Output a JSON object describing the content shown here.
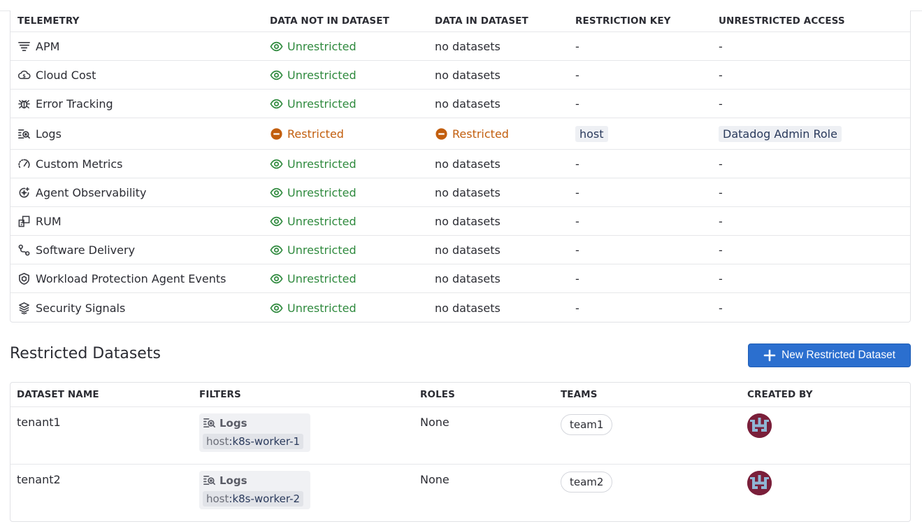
{
  "telemetry_table": {
    "headers": [
      "TELEMETRY",
      "DATA NOT IN DATASET",
      "DATA IN DATASET",
      "RESTRICTION KEY",
      "UNRESTRICTED ACCESS"
    ],
    "rows": [
      {
        "name": "APM",
        "icon": "apm-icon",
        "not_in_dataset": "Unrestricted",
        "not_in_status": "unrestricted",
        "in_dataset": "no datasets",
        "in_status": "text",
        "restriction_key": "-",
        "unrestricted_access": "-"
      },
      {
        "name": "Cloud Cost",
        "icon": "cloud-cost-icon",
        "not_in_dataset": "Unrestricted",
        "not_in_status": "unrestricted",
        "in_dataset": "no datasets",
        "in_status": "text",
        "restriction_key": "-",
        "unrestricted_access": "-"
      },
      {
        "name": "Error Tracking",
        "icon": "bug-icon",
        "not_in_dataset": "Unrestricted",
        "not_in_status": "unrestricted",
        "in_dataset": "no datasets",
        "in_status": "text",
        "restriction_key": "-",
        "unrestricted_access": "-"
      },
      {
        "name": "Logs",
        "icon": "logs-icon",
        "not_in_dataset": "Restricted",
        "not_in_status": "restricted",
        "in_dataset": "Restricted",
        "in_status": "restricted",
        "restriction_key": "host",
        "unrestricted_access": "Datadog Admin Role"
      },
      {
        "name": "Custom Metrics",
        "icon": "gauge-icon",
        "not_in_dataset": "Unrestricted",
        "not_in_status": "unrestricted",
        "in_dataset": "no datasets",
        "in_status": "text",
        "restriction_key": "-",
        "unrestricted_access": "-"
      },
      {
        "name": "Agent Observability",
        "icon": "agent-icon",
        "not_in_dataset": "Unrestricted",
        "not_in_status": "unrestricted",
        "in_dataset": "no datasets",
        "in_status": "text",
        "restriction_key": "-",
        "unrestricted_access": "-"
      },
      {
        "name": "RUM",
        "icon": "rum-icon",
        "not_in_dataset": "Unrestricted",
        "not_in_status": "unrestricted",
        "in_dataset": "no datasets",
        "in_status": "text",
        "restriction_key": "-",
        "unrestricted_access": "-"
      },
      {
        "name": "Software Delivery",
        "icon": "delivery-icon",
        "not_in_dataset": "Unrestricted",
        "not_in_status": "unrestricted",
        "in_dataset": "no datasets",
        "in_status": "text",
        "restriction_key": "-",
        "unrestricted_access": "-"
      },
      {
        "name": "Workload Protection Agent Events",
        "icon": "shield-icon",
        "not_in_dataset": "Unrestricted",
        "not_in_status": "unrestricted",
        "in_dataset": "no datasets",
        "in_status": "text",
        "restriction_key": "-",
        "unrestricted_access": "-"
      },
      {
        "name": "Security Signals",
        "icon": "signals-icon",
        "not_in_dataset": "Unrestricted",
        "not_in_status": "unrestricted",
        "in_dataset": "no datasets",
        "in_status": "text",
        "restriction_key": "-",
        "unrestricted_access": "-"
      }
    ]
  },
  "restricted_datasets": {
    "title": "Restricted Datasets",
    "new_button_label": "New Restricted Dataset",
    "headers": [
      "DATASET NAME",
      "FILTERS",
      "ROLES",
      "TEAMS",
      "CREATED BY"
    ],
    "rows": [
      {
        "name": "tenant1",
        "filter_product": "Logs",
        "filter_key": "host",
        "filter_value": ":k8s-worker-1",
        "roles": "None",
        "team": "team1"
      },
      {
        "name": "tenant2",
        "filter_product": "Logs",
        "filter_key": "host",
        "filter_value": ":k8s-worker-2",
        "roles": "None",
        "team": "team2"
      }
    ]
  },
  "colors": {
    "unrestricted": "#2f8a3e",
    "restricted": "#c25e0e",
    "primary_button": "#2b6fcf",
    "avatar": "#7a1f3a"
  }
}
